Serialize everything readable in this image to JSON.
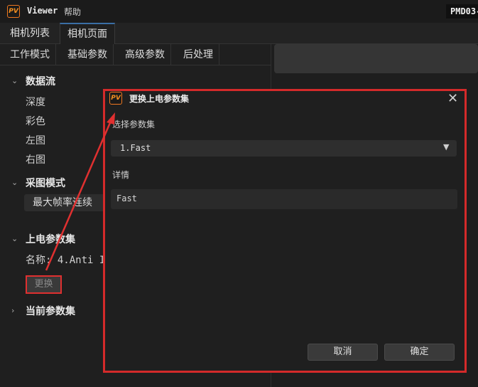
{
  "app": {
    "logo_text": "PV",
    "title": "Viewer",
    "menu_help": "帮助",
    "device_name": "PMD03-"
  },
  "main_tabs": [
    {
      "label": "相机列表"
    },
    {
      "label": "相机页面"
    }
  ],
  "sub_tabs": [
    {
      "label": "工作模式"
    },
    {
      "label": "基础参数"
    },
    {
      "label": "高级参数"
    },
    {
      "label": "后处理"
    }
  ],
  "left": {
    "data_stream": {
      "title": "数据流",
      "items": [
        "深度",
        "彩色",
        "左图",
        "右图"
      ]
    },
    "capture_mode": {
      "title": "采图模式",
      "value": "最大帧率连续"
    },
    "power_param_set": {
      "title": "上电参数集",
      "name_label": "名称: 4.Anti I",
      "change_button": "更换"
    },
    "current_param_set": {
      "title": "当前参数集"
    }
  },
  "dialog": {
    "logo_text": "PV",
    "title": "更换上电参数集",
    "select_label": "选择参数集",
    "select_value": "1.Fast",
    "detail_label": "详情",
    "detail_value": "Fast",
    "cancel_button": "取消",
    "ok_button": "确定"
  },
  "icons": {
    "close": "close-icon",
    "expand": "chevron-down-icon",
    "collapse": "chevron-right-icon",
    "dropdown": "dropdown-arrow-icon"
  },
  "colors": {
    "annotation_red": "#d42a2a",
    "logo_orange": "#f07820",
    "tab_accent": "#3a6ea5"
  }
}
